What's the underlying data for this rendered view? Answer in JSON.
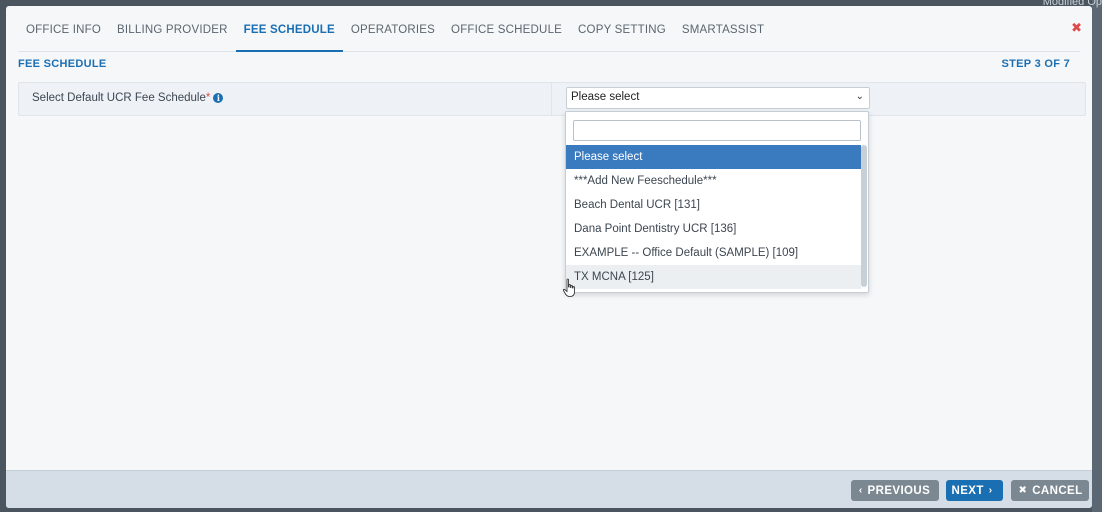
{
  "backdrop": {
    "corner_text": "Modified Op"
  },
  "tabs": [
    {
      "label": "OFFICE INFO",
      "active": false
    },
    {
      "label": "BILLING PROVIDER",
      "active": false
    },
    {
      "label": "FEE SCHEDULE",
      "active": true
    },
    {
      "label": "OPERATORIES",
      "active": false
    },
    {
      "label": "OFFICE SCHEDULE",
      "active": false
    },
    {
      "label": "COPY SETTING",
      "active": false
    },
    {
      "label": "SMARTASSIST",
      "active": false
    }
  ],
  "close_icon": "close-icon",
  "section": {
    "title": "FEE SCHEDULE",
    "step": "STEP 3 OF 7"
  },
  "form": {
    "label": "Select Default UCR Fee Schedule",
    "required_mark": "*",
    "info_icon": "info-icon",
    "select_value": "Please select",
    "search_value": ""
  },
  "dropdown": {
    "options": [
      {
        "label": "Please select",
        "state": "selected"
      },
      {
        "label": "***Add New Feeschedule***",
        "state": "normal"
      },
      {
        "label": "Beach Dental UCR [131]",
        "state": "normal"
      },
      {
        "label": "Dana Point Dentistry UCR [136]",
        "state": "normal"
      },
      {
        "label": "EXAMPLE -- Office Default (SAMPLE) [109]",
        "state": "normal"
      },
      {
        "label": "TX MCNA [125]",
        "state": "hover"
      }
    ]
  },
  "footer": {
    "previous_label": "PREVIOUS",
    "next_label": "NEXT",
    "cancel_label": "CANCEL"
  },
  "colors": {
    "accent": "#1a6fb3",
    "selected_option": "#3a7abf",
    "secondary_button": "#7c8891",
    "required": "#e04a4a"
  }
}
